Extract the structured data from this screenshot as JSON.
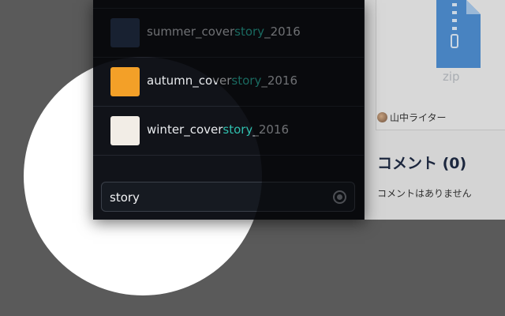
{
  "results": [
    {
      "prefix": "summer_cover",
      "match": "story",
      "suffix": "_2016",
      "color": "#2c3c5a"
    },
    {
      "prefix": "autumn_cover",
      "match": "story",
      "suffix": "_2016",
      "color": "#f3a028"
    },
    {
      "prefix": "winter_cover",
      "match": "story",
      "suffix": "_2016",
      "color": "#f2ede6"
    }
  ],
  "search": {
    "value": "story",
    "clear_icon": "clear-circle-icon"
  },
  "file": {
    "type_label": "zip",
    "uploader": "山中ライター",
    "icon": "zip-file-icon"
  },
  "comments": {
    "title": "コメント (0)",
    "empty_text": "コメントはありません"
  },
  "colors": {
    "highlight": "#2fbfae",
    "popup_bg": "#111319",
    "file_icon": "#4f8fd2"
  }
}
